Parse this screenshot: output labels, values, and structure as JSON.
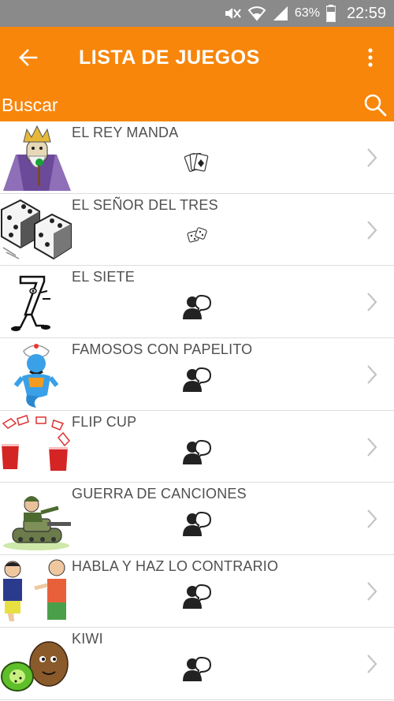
{
  "status_bar": {
    "battery": "63%",
    "time": "22:59",
    "icons": [
      "mute-icon",
      "wifi-icon",
      "signal-icon",
      "battery-icon"
    ]
  },
  "app_bar": {
    "title": "LISTA DE JUEGOS",
    "back_icon": "arrow-left-icon",
    "menu_icon": "more-vertical-icon",
    "background": "#f7860b"
  },
  "search": {
    "placeholder": "Buscar",
    "icon": "search-icon"
  },
  "games": [
    {
      "name": "EL REY MANDA",
      "type_icon": "cards-icon",
      "thumb": "king-icon"
    },
    {
      "name": "EL SEÑOR DEL TRES",
      "type_icon": "dice-small-icon",
      "thumb": "dice-icon"
    },
    {
      "name": "EL SIETE",
      "type_icon": "person-speech-icon",
      "thumb": "seven-icon"
    },
    {
      "name": "FAMOSOS CON PAPELITO",
      "type_icon": "person-speech-icon",
      "thumb": "genie-icon"
    },
    {
      "name": "FLIP CUP",
      "type_icon": "person-speech-icon",
      "thumb": "cups-icon"
    },
    {
      "name": "GUERRA DE CANCIONES",
      "type_icon": "person-speech-icon",
      "thumb": "soldier-tank-icon"
    },
    {
      "name": "HABLA Y HAZ LO CONTRARIO",
      "type_icon": "person-speech-icon",
      "thumb": "two-men-icon"
    },
    {
      "name": "KIWI",
      "type_icon": "person-speech-icon",
      "thumb": "kiwi-icon"
    }
  ]
}
